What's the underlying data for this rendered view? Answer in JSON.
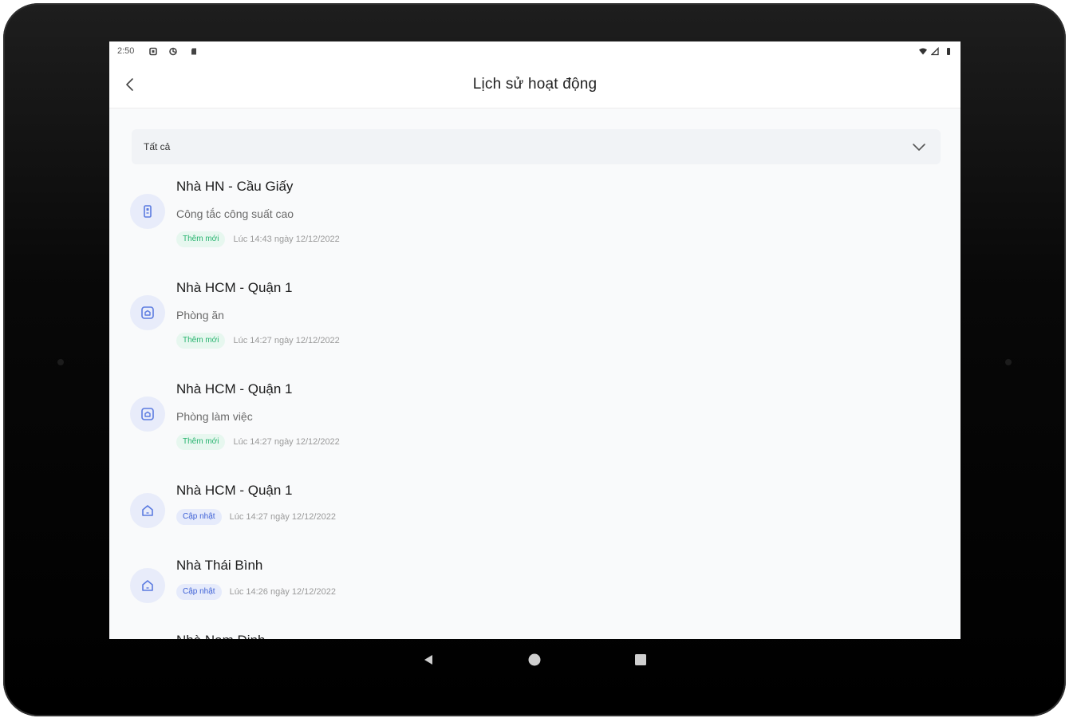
{
  "status": {
    "time": "2:50"
  },
  "header": {
    "title": "Lịch sử hoạt động"
  },
  "filter": {
    "selected": "Tất cả"
  },
  "colors": {
    "accent": "#3f62d6",
    "success": "#26b36e",
    "icon_bg": "#e8ecfa"
  },
  "activities": [
    {
      "title": "Nhà HN - Cầu Giấy",
      "subtitle": "Công tắc công suất cao",
      "badge": "Thêm mới",
      "badge_type": "new",
      "time": "Lúc 14:43 ngày 12/12/2022",
      "icon": "switch-device-icon"
    },
    {
      "title": "Nhà HCM - Quận 1",
      "subtitle": "Phòng ăn",
      "badge": "Thêm mới",
      "badge_type": "new",
      "time": "Lúc 14:27 ngày 12/12/2022",
      "icon": "room-icon"
    },
    {
      "title": "Nhà HCM - Quận 1",
      "subtitle": "Phòng làm việc",
      "badge": "Thêm mới",
      "badge_type": "new",
      "time": "Lúc 14:27 ngày 12/12/2022",
      "icon": "room-icon"
    },
    {
      "title": "Nhà HCM - Quận 1",
      "badge": "Cập nhật",
      "badge_type": "update",
      "time": "Lúc 14:27 ngày 12/12/2022",
      "icon": "home-icon"
    },
    {
      "title": "Nhà Thái Bình",
      "badge": "Cập nhật",
      "badge_type": "update",
      "time": "Lúc 14:26 ngày 12/12/2022",
      "icon": "home-icon"
    },
    {
      "title": "Nhà Nam Định",
      "icon": "home-icon"
    }
  ]
}
